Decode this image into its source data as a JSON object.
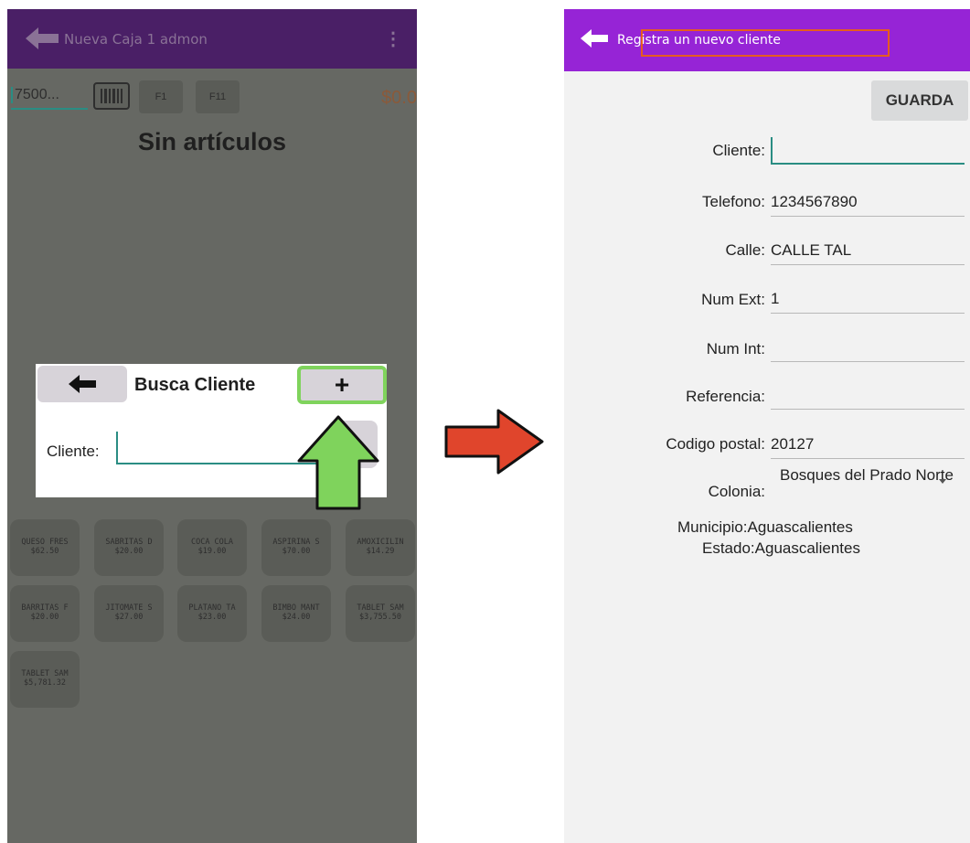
{
  "left": {
    "appbar": {
      "title": "Nueva Caja 1 admon",
      "menu": "⋮"
    },
    "toolbar": {
      "amount": "7500...",
      "f1": "F1",
      "f11": "F11",
      "total": "$0.0"
    },
    "empty_title": "Sin artículos",
    "dialog": {
      "title": "Busca Cliente",
      "plus": "+",
      "label": "Cliente:"
    },
    "products": [
      {
        "name": "QUESO FRES",
        "price": "$62.50"
      },
      {
        "name": "SABRITAS D",
        "price": "$20.00"
      },
      {
        "name": "COCA COLA",
        "price": "$19.00"
      },
      {
        "name": "ASPIRINA S",
        "price": "$70.00"
      },
      {
        "name": "AMOXICILIN",
        "price": "$14.29"
      },
      {
        "name": "BARRITAS F",
        "price": "$20.00"
      },
      {
        "name": "JITOMATE S",
        "price": "$27.00"
      },
      {
        "name": "PLATANO TA",
        "price": "$23.00"
      },
      {
        "name": "BIMBO MANT",
        "price": "$24.00"
      },
      {
        "name": "TABLET SAM",
        "price": "$3,755.50"
      },
      {
        "name": "TABLET SAM",
        "price": "$5,781.32"
      }
    ]
  },
  "right": {
    "appbar": {
      "title": "Registra un nuevo cliente"
    },
    "save_label": "GUARDA",
    "form": {
      "cliente": {
        "label": "Cliente:",
        "value": ""
      },
      "telefono": {
        "label": "Telefono:",
        "value": "1234567890"
      },
      "calle": {
        "label": "Calle:",
        "value": "CALLE TAL"
      },
      "num_ext": {
        "label": "Num Ext:",
        "value": "1"
      },
      "num_int": {
        "label": "Num Int:",
        "value": ""
      },
      "referencia": {
        "label": "Referencia:",
        "value": ""
      },
      "codigo_postal": {
        "label": "Codigo postal:",
        "value": "20127"
      },
      "colonia": {
        "label": "Colonia:",
        "value": "Bosques del Prado Norte"
      },
      "municipio": "Municipio:Aguascalientes",
      "estado": "Estado:Aguascalientes"
    }
  },
  "colors": {
    "left_appbar": "#4a1f66",
    "right_appbar": "#9624d6",
    "accent_teal": "#2a8d83",
    "highlight_green": "#7fd35c",
    "highlight_orange": "#e65c1f",
    "arrow_red": "#e0452c"
  }
}
